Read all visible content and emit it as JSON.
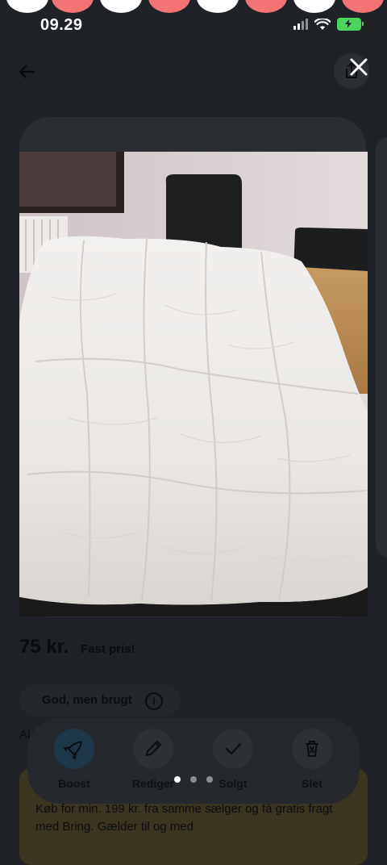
{
  "status_bar": {
    "time": "09.29",
    "icons": [
      "signal-icon",
      "wifi-icon",
      "battery-charging-icon"
    ],
    "top_dot_colors": [
      "#ffffff",
      "#f37474",
      "#ffffff",
      "#f37474",
      "#ffffff",
      "#f37474",
      "#ffffff",
      "#f37474"
    ]
  },
  "header": {
    "back_icon": "arrow-left-icon",
    "share_icon": "share-icon",
    "close_icon": "close-icon"
  },
  "listing": {
    "price": "75 kr.",
    "price_note": "Fast pris!",
    "condition": "God, men brugt",
    "info_glyph": "i",
    "description_start": "Al",
    "promo_text": "Køb for min. 199 kr. fra samme sælger og få gratis fragt med Bring. Gælder til og med"
  },
  "actions": [
    {
      "label": "Boost",
      "icon": "rocket-icon"
    },
    {
      "label": "Rediger",
      "icon": "pencil-icon"
    },
    {
      "label": "Solgt",
      "icon": "check-icon"
    },
    {
      "label": "Slet",
      "icon": "trash-icon"
    }
  ],
  "gallery": {
    "image_count": 3,
    "active_index": 0
  },
  "colors": {
    "background": "#1f2226",
    "accent_red": "#f37474",
    "battery_green": "#4fd35f"
  }
}
